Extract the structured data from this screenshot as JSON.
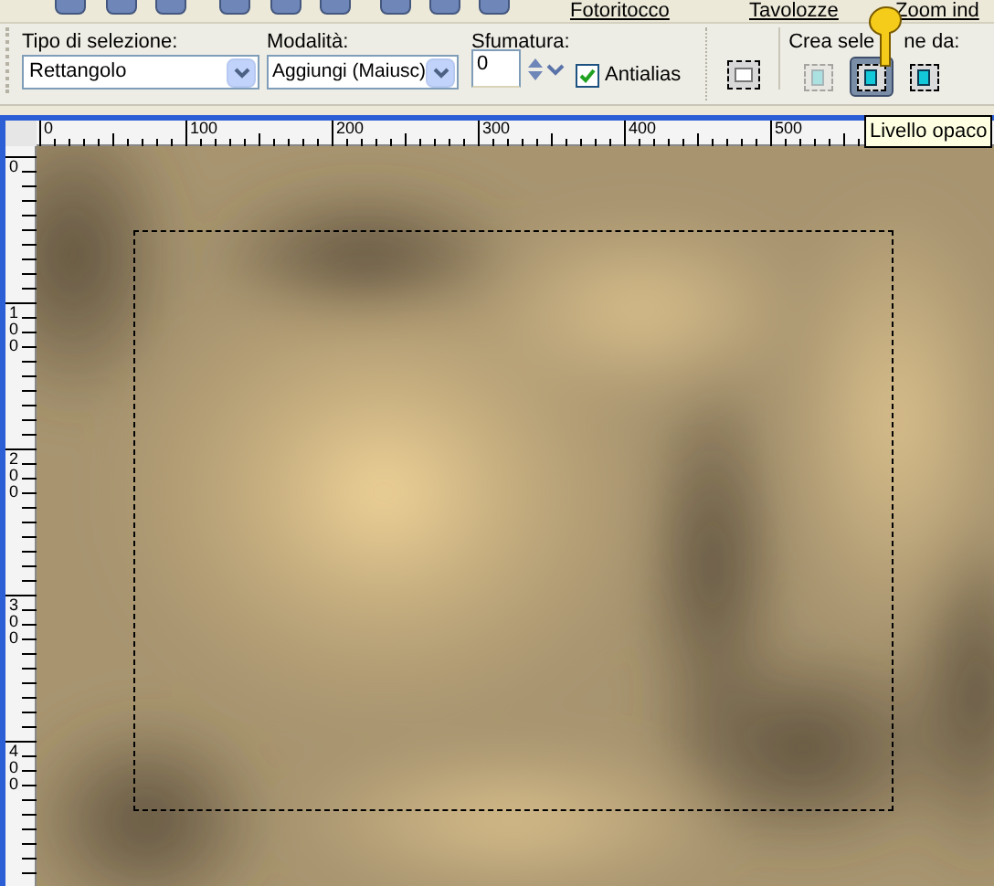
{
  "top_toolbar": {
    "labels": [
      "Fotoritocco",
      "Tavolozze",
      "Zoom ind"
    ]
  },
  "options": {
    "selection_type": {
      "label": "Tipo di selezione:",
      "value": "Rettangolo"
    },
    "mode": {
      "label": "Modalità:",
      "value": "Aggiungi (Maiusc)"
    },
    "feather": {
      "label": "Sfumatura:",
      "value": "0"
    },
    "antialias": {
      "label": "Antialias",
      "checked": true
    },
    "create_from": {
      "label_parts": [
        "Crea sele",
        "ne da:"
      ],
      "buttons": [
        {
          "selected": false,
          "disabled": true
        },
        {
          "selected": true,
          "disabled": false
        },
        {
          "selected": false,
          "disabled": false
        }
      ]
    }
  },
  "tooltip": "Livello opaco",
  "rulers": {
    "horizontal": [
      "0",
      "100",
      "200",
      "300",
      "400",
      "500"
    ],
    "vertical": [
      "0",
      "100",
      "200",
      "300",
      "400"
    ]
  }
}
